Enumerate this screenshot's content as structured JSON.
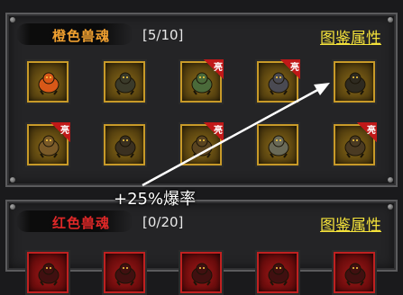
{
  "sections": [
    {
      "title": "橙色兽魂",
      "count": "[5/10]",
      "codex_label": "图鉴属性",
      "color": "#f0a030",
      "slots": [
        {
          "badge": "",
          "icon": "orange-serpent-icon",
          "hue": "#d85818"
        },
        {
          "badge": "",
          "icon": "stone-golem-icon",
          "hue": "#3a3a2a"
        },
        {
          "badge": "亮",
          "icon": "green-beast-icon",
          "hue": "#4a6a3a"
        },
        {
          "badge": "亮",
          "icon": "grey-beast-icon",
          "hue": "#4a4a52"
        },
        {
          "badge": "",
          "icon": "dark-beast-icon",
          "hue": "#2e2a20"
        },
        {
          "badge": "亮",
          "icon": "bear-beast-icon",
          "hue": "#7a5a28"
        },
        {
          "badge": "",
          "icon": "horned-beast-icon",
          "hue": "#3a3020"
        },
        {
          "badge": "亮",
          "icon": "armored-beast-icon",
          "hue": "#5a4420"
        },
        {
          "badge": "",
          "icon": "white-warrior-icon",
          "hue": "#6a6a58"
        },
        {
          "badge": "亮",
          "icon": "clawed-beast-icon",
          "hue": "#4a3a22"
        }
      ]
    },
    {
      "title": "红色兽魂",
      "count": "[0/20]",
      "codex_label": "图鉴属性",
      "color": "#e02828",
      "slots": [
        {
          "badge": "",
          "icon": "red-beast-icon",
          "hue": "#401010"
        },
        {
          "badge": "",
          "icon": "red-beast-icon",
          "hue": "#401010"
        },
        {
          "badge": "",
          "icon": "red-beast-icon",
          "hue": "#401010"
        },
        {
          "badge": "",
          "icon": "red-beast-icon",
          "hue": "#401010"
        },
        {
          "badge": "",
          "icon": "red-beast-icon",
          "hue": "#401010"
        }
      ]
    }
  ],
  "annotation": {
    "text": "+25%爆率",
    "color": "#ffffff"
  }
}
